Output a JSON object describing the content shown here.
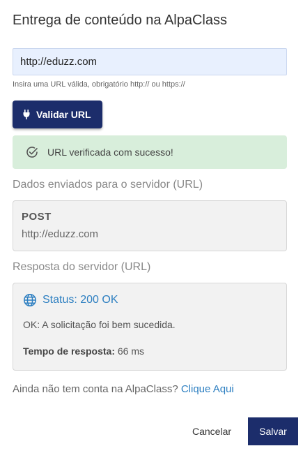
{
  "dialog": {
    "title": "Entrega de conteúdo na AlpaClass"
  },
  "url_field": {
    "value": "http://eduzz.com",
    "helper": "Insira uma URL válida, obrigatório http:// ou https://"
  },
  "validate_button": {
    "label": "Validar URL",
    "icon": "plug-icon"
  },
  "success_alert": {
    "icon": "check-circle-icon",
    "message": "URL verificada com sucesso!",
    "color": "#d8eedb"
  },
  "request": {
    "section_label": "Dados enviados para o servidor (URL)",
    "method": "POST",
    "url": "http://eduzz.com"
  },
  "response": {
    "section_label": "Resposta do servidor (URL)",
    "status_icon": "globe-icon",
    "status": "Status: 200 OK",
    "message": "OK: A solicitação foi bem sucedida.",
    "time_label": "Tempo de resposta:",
    "time_value": "66 ms"
  },
  "account": {
    "text": "Ainda não tem conta na AlpaClass?",
    "link": "Clique Aqui"
  },
  "footer": {
    "cancel_label": "Cancelar",
    "save_label": "Salvar"
  },
  "colors": {
    "primary": "#1c2d6b",
    "link": "#2d7fc1"
  }
}
